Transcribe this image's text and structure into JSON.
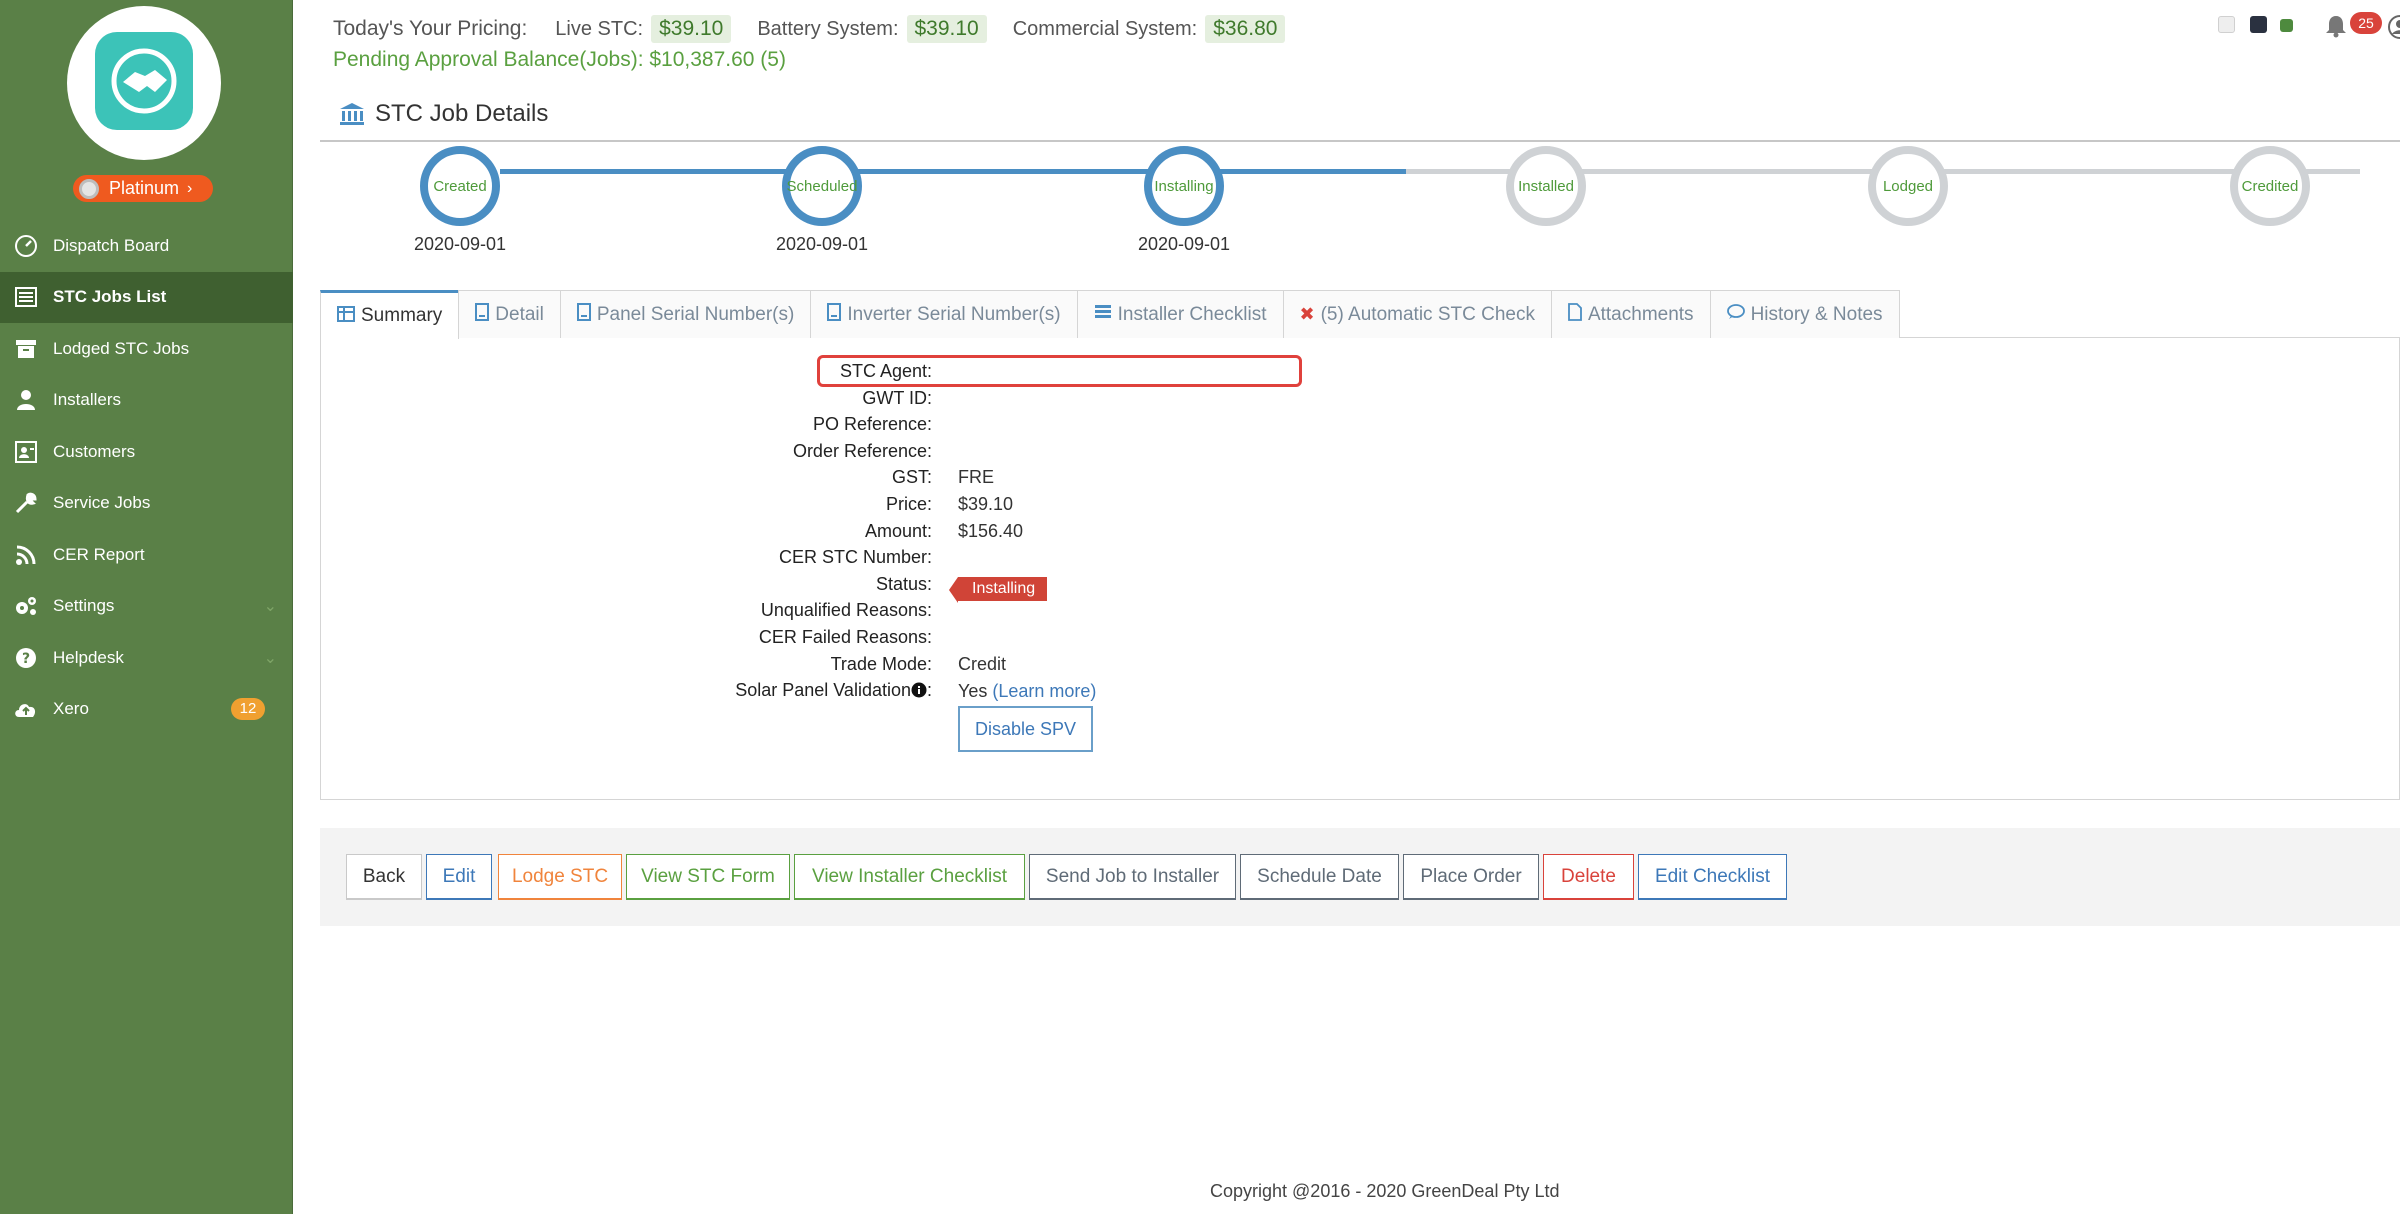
{
  "sidebar": {
    "badge": "Platinum",
    "items": [
      {
        "label": "Dispatch Board",
        "icon": "gauge-icon"
      },
      {
        "label": "STC Jobs List",
        "icon": "list-icon",
        "active": true
      },
      {
        "label": "Lodged STC Jobs",
        "icon": "archive-icon"
      },
      {
        "label": "Installers",
        "icon": "user-icon"
      },
      {
        "label": "Customers",
        "icon": "contact-card-icon"
      },
      {
        "label": "Service Jobs",
        "icon": "wrench-icon"
      },
      {
        "label": "CER Report",
        "icon": "rss-icon"
      },
      {
        "label": "Settings",
        "icon": "gears-icon"
      },
      {
        "label": "Helpdesk",
        "icon": "question-icon"
      },
      {
        "label": "Xero",
        "icon": "cloud-upload-icon",
        "count": "12"
      }
    ]
  },
  "header": {
    "pricing_label": "Today's Your Pricing:",
    "live_stc_label": "Live STC:",
    "live_stc_value": "$39.10",
    "battery_label": "Battery System:",
    "battery_value": "$39.10",
    "commercial_label": "Commercial System:",
    "commercial_value": "$36.80",
    "pending": "Pending Approval Balance(Jobs): $10,387.60 (5)",
    "notifications": "25"
  },
  "page": {
    "title": "STC Job Details"
  },
  "stages": [
    {
      "label": "Created",
      "date": "2020-09-01",
      "done": true
    },
    {
      "label": "Scheduled",
      "date": "2020-09-01",
      "done": true
    },
    {
      "label": "Installing",
      "date": "2020-09-01",
      "done": true
    },
    {
      "label": "Installed",
      "date": "",
      "done": false
    },
    {
      "label": "Lodged",
      "date": "",
      "done": false
    },
    {
      "label": "Credited",
      "date": "",
      "done": false
    }
  ],
  "tabs": [
    {
      "label": "Summary",
      "icon": "table-icon",
      "active": true
    },
    {
      "label": "Detail",
      "icon": "file-icon"
    },
    {
      "label": "Panel Serial Number(s)",
      "icon": "file-icon"
    },
    {
      "label": "Inverter Serial Number(s)",
      "icon": "file-icon"
    },
    {
      "label": "Installer Checklist",
      "icon": "checklist-icon"
    },
    {
      "label": "(5)  Automatic STC Check",
      "icon": "x-icon"
    },
    {
      "label": "Attachments",
      "icon": "doc-icon"
    },
    {
      "label": "History & Notes",
      "icon": "comment-icon"
    }
  ],
  "summary": {
    "fields": [
      {
        "label": "STC Agent:",
        "value": ""
      },
      {
        "label": "GWT ID:",
        "value": ""
      },
      {
        "label": "PO Reference:",
        "value": ""
      },
      {
        "label": "Order Reference:",
        "value": ""
      },
      {
        "label": "GST:",
        "value": "FRE"
      },
      {
        "label": "Price:",
        "value": "$39.10"
      },
      {
        "label": "Amount:",
        "value": "$156.40"
      },
      {
        "label": "CER STC Number:",
        "value": ""
      },
      {
        "label": "Status:",
        "value": ""
      },
      {
        "label": "Unqualified Reasons:",
        "value": ""
      },
      {
        "label": "CER Failed Reasons:",
        "value": ""
      },
      {
        "label": "Trade Mode:",
        "value": "Credit"
      },
      {
        "label": "Solar Panel Validation",
        "value": "Yes"
      }
    ],
    "status_tag": "Installing",
    "learn_more": "(Learn more)",
    "spv_colon": ":",
    "disable_spv": "Disable SPV"
  },
  "actions": [
    {
      "label": "Back",
      "color": "#333333"
    },
    {
      "label": "Edit",
      "color": "#3d78b8"
    },
    {
      "label": "Lodge STC",
      "color": "#f0843c"
    },
    {
      "label": "View STC Form",
      "color": "#5aa040"
    },
    {
      "label": "View Installer Checklist",
      "color": "#5aa040"
    },
    {
      "label": "Send Job to Installer",
      "color": "#5f6b77"
    },
    {
      "label": "Schedule Date",
      "color": "#5f6b77"
    },
    {
      "label": "Place Order",
      "color": "#5f6b77"
    },
    {
      "label": "Delete",
      "color": "#d9433b"
    },
    {
      "label": "Edit Checklist",
      "color": "#3d78b8"
    }
  ],
  "footer": "Copyright @2016 - 2020 GreenDeal Pty Ltd",
  "colors": {
    "sidebar": "#5a8047",
    "accent": "#4a8ec3",
    "price_green": "#3f7a2c"
  }
}
